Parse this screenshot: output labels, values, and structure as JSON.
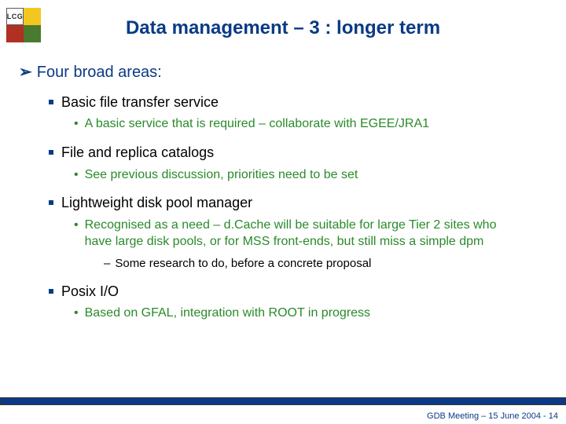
{
  "logo": {
    "text": "LCG"
  },
  "title": "Data management – 3 : longer term",
  "outline": {
    "l1": "Four broad areas:",
    "items": [
      {
        "l2": "Basic file transfer service",
        "l3": [
          "A basic service that is required – collaborate with EGEE/JRA1"
        ]
      },
      {
        "l2": "File and replica catalogs",
        "l3": [
          "See previous discussion, priorities need to be set"
        ]
      },
      {
        "l2": "Lightweight disk pool manager",
        "l3": [
          "Recognised as a need – d.Cache will be suitable for large Tier 2 sites who have large disk pools, or for MSS front-ends, but still miss a simple dpm"
        ],
        "l4": [
          "Some research to do, before a concrete proposal"
        ]
      },
      {
        "l2": "Posix I/O",
        "l3": [
          "Based on GFAL, integration with ROOT in progress"
        ]
      }
    ]
  },
  "footer": "GDB Meeting – 15 June 2004  - 14"
}
